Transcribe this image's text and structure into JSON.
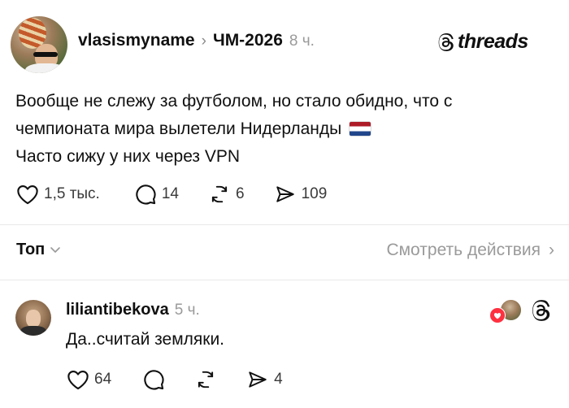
{
  "post": {
    "username": "vlasismyname",
    "separator": "›",
    "topic": "ЧМ-2026",
    "time": "8 ч.",
    "brand": "threads",
    "lines": [
      "Вообще не слежу за футболом, но стало обидно, что с",
      "чемпионата мира вылетели Нидерланды",
      "Часто сижу у них через VPN"
    ],
    "flag_icon": "netherlands-flag-icon",
    "likes": "1,5 тыс.",
    "replies": "14",
    "reposts": "6",
    "shares": "109"
  },
  "sort": {
    "label": "Топ",
    "activity_link": "Смотреть действия",
    "activity_chevron": "›"
  },
  "comment": {
    "username": "liliantibekova",
    "time": "5 ч.",
    "text": "Да..считай земляки.",
    "likes": "64",
    "replies": "",
    "reposts": "",
    "shares": "4"
  },
  "colors": {
    "text": "#101010",
    "muted": "#9a9a9a",
    "divider": "#e9e9e9",
    "heart_badge": "#ff3040"
  }
}
